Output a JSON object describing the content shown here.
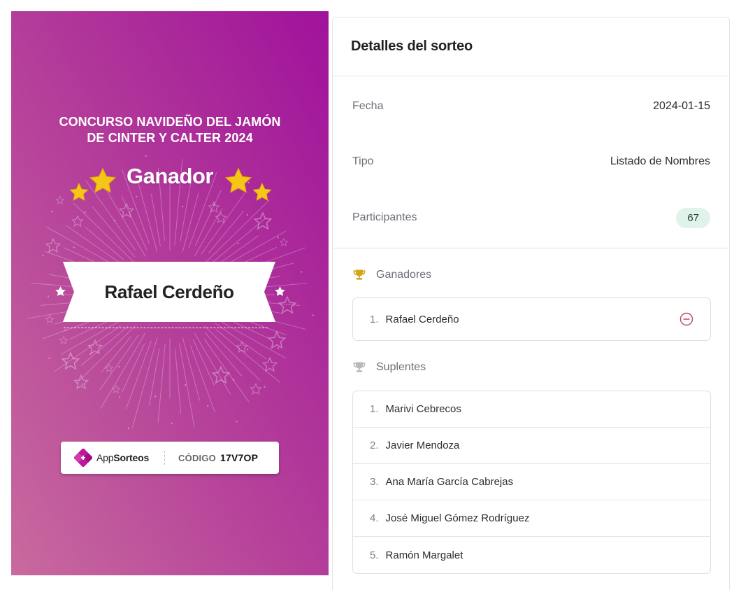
{
  "poster": {
    "title_line1": "CONCURSO NAVIDEÑO DEL JAMÓN",
    "title_line2": "DE CINTER Y CALTER 2024",
    "winner_heading": "Ganador",
    "winner_name": "Rafael Cerdeño",
    "brand_prefix": "App",
    "brand_suffix": "Sorteos",
    "code_label": "CÓDIGO",
    "code_value": "17V7OP",
    "colors": {
      "gradient_top": "#a0129b",
      "gradient_bottom": "#c96a9e",
      "star": "#f5c518"
    }
  },
  "details": {
    "title": "Detalles del sorteo",
    "rows": [
      {
        "label": "Fecha",
        "value": "2024-01-15"
      },
      {
        "label": "Tipo",
        "value": "Listado de Nombres"
      },
      {
        "label": "Participantes",
        "value": "67"
      }
    ],
    "winners": {
      "title": "Ganadores",
      "icon": "gold-trophy-icon",
      "items": [
        {
          "num": "1.",
          "name": "Rafael Cerdeño"
        }
      ]
    },
    "substitutes": {
      "title": "Suplentes",
      "icon": "silver-trophy-icon",
      "items": [
        {
          "num": "1.",
          "name": "Marivi Cebrecos"
        },
        {
          "num": "2.",
          "name": "Javier Mendoza"
        },
        {
          "num": "3.",
          "name": "Ana María García Cabrejas"
        },
        {
          "num": "4.",
          "name": "José Miguel Gómez Rodríguez"
        },
        {
          "num": "5.",
          "name": "Ramón Margalet"
        }
      ]
    },
    "colors": {
      "badge_bg": "#dff3ea",
      "remove_icon": "#c0485f",
      "gold": "#d4a514",
      "silver": "#b8b8b8"
    }
  }
}
